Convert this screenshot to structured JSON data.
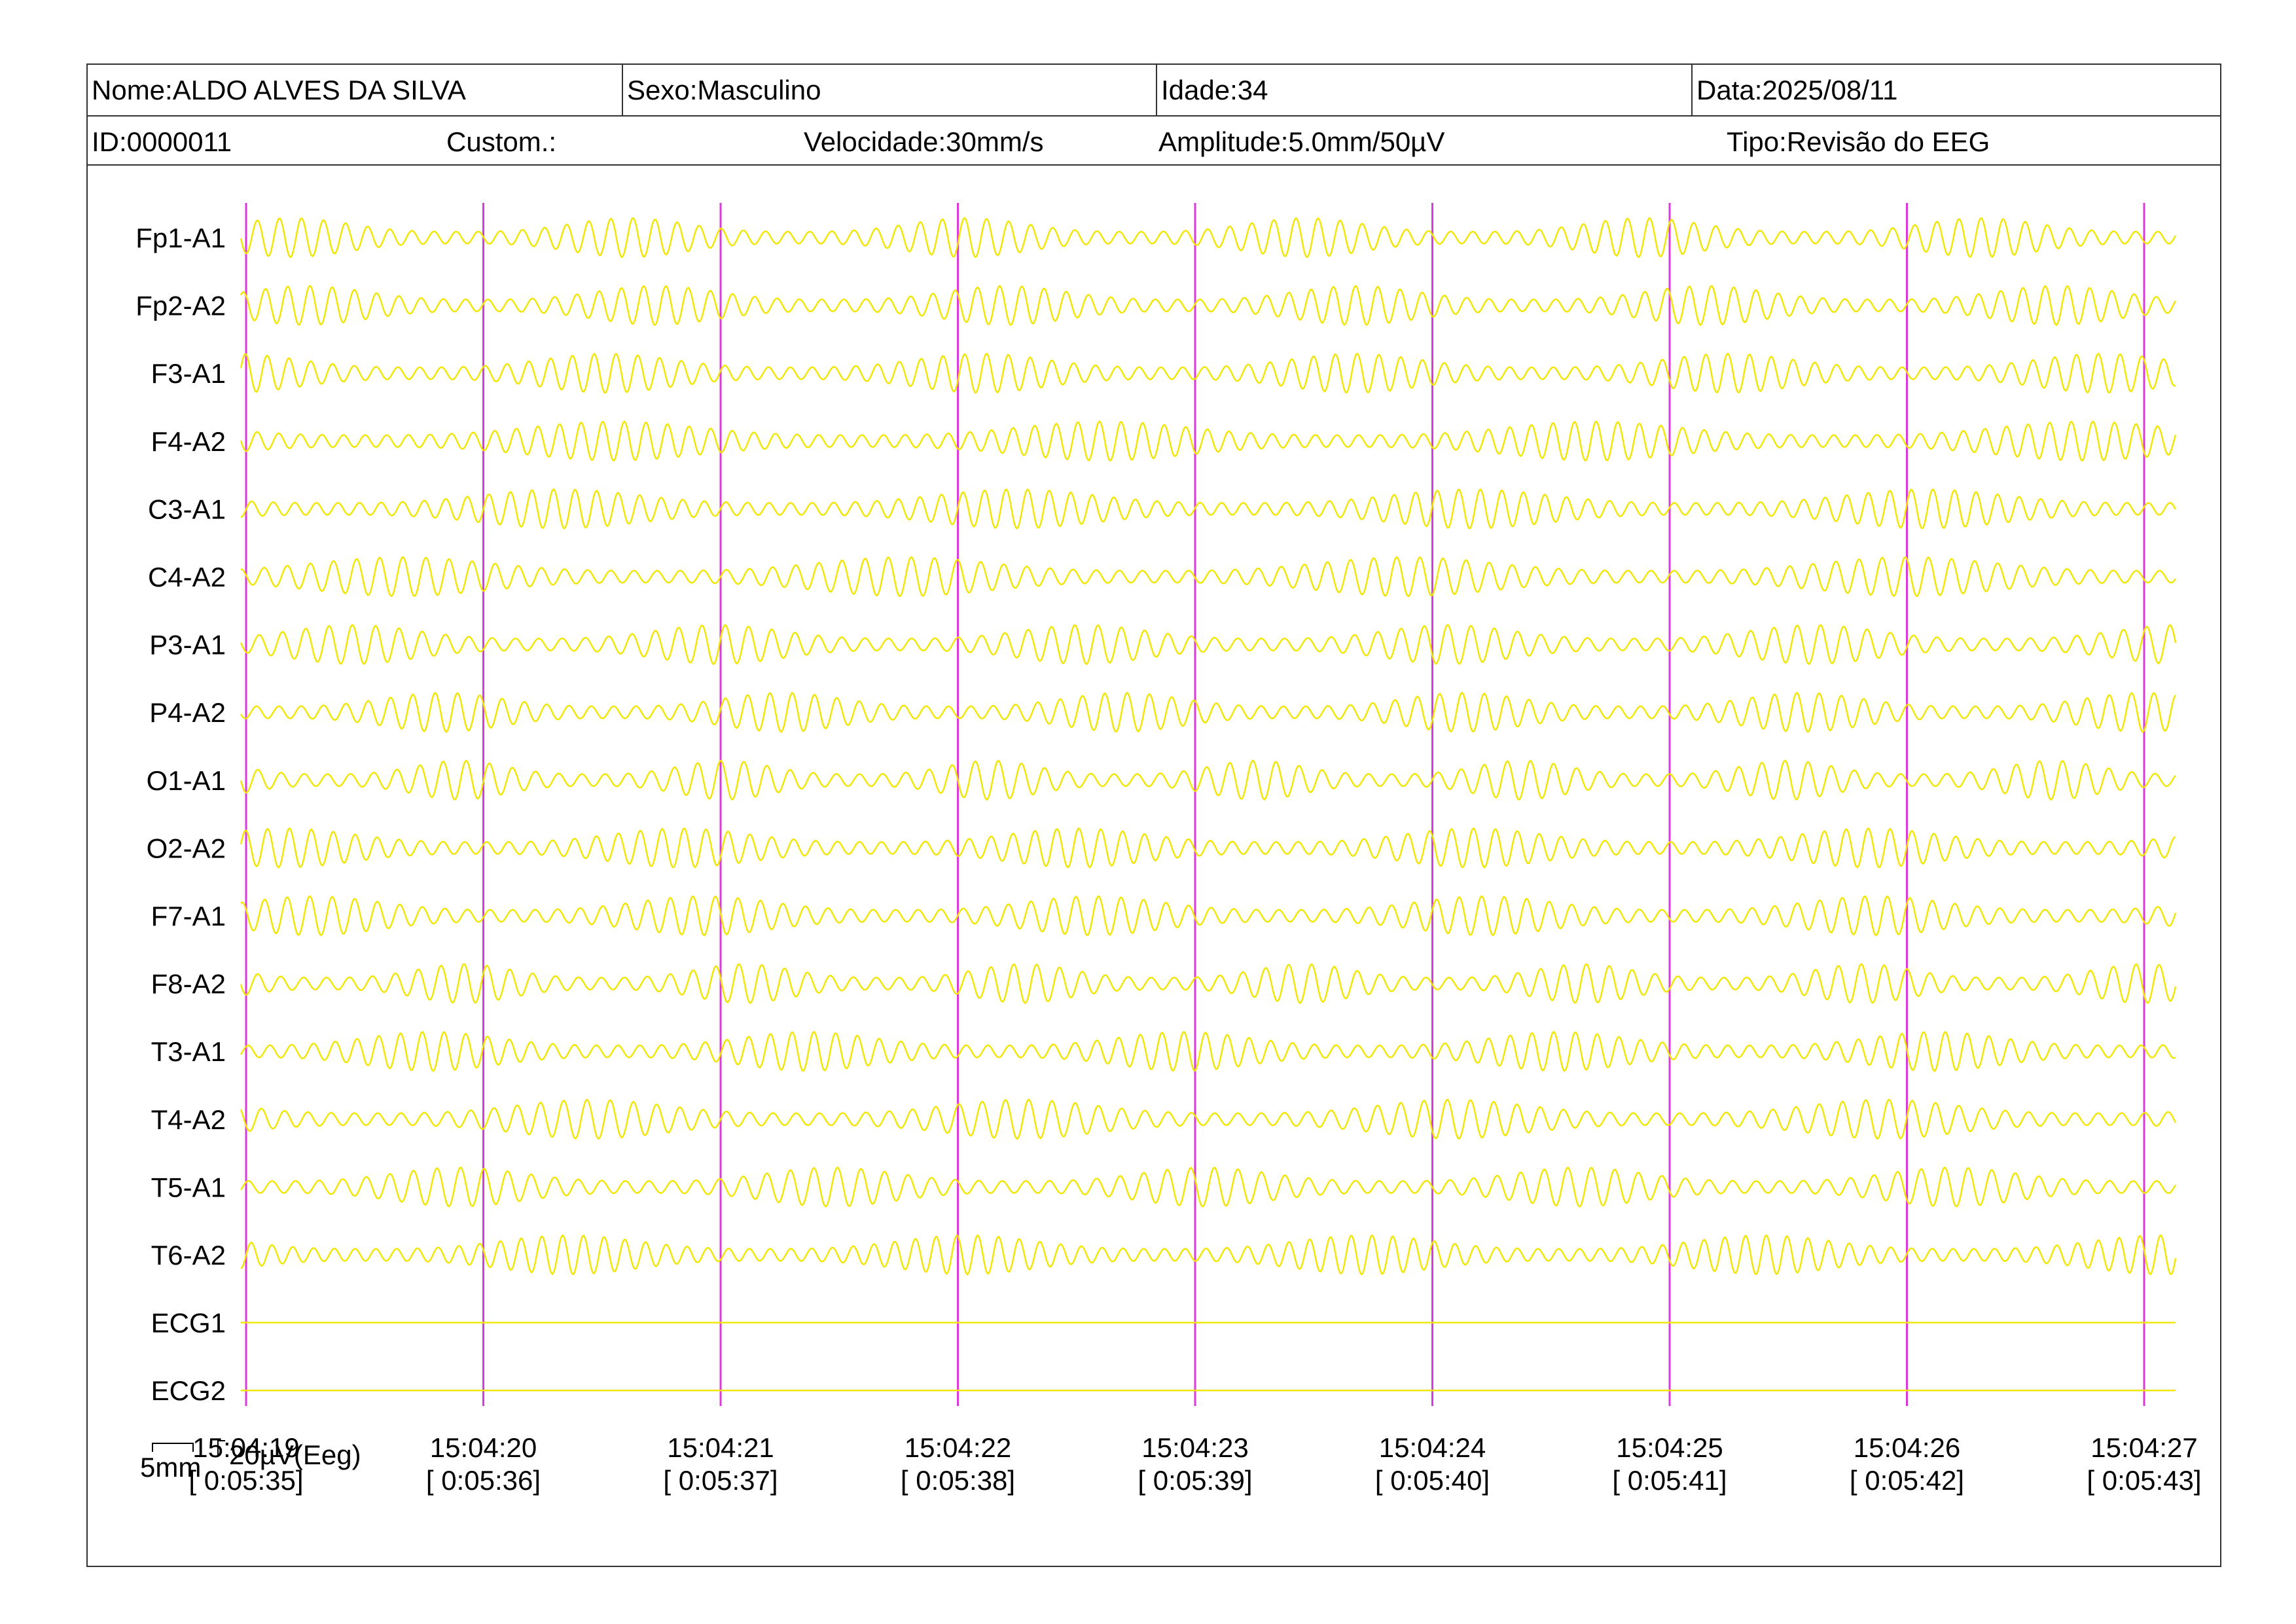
{
  "header": {
    "name": "Nome:ALDO ALVES DA SILVA",
    "sex": "Sexo:Masculino",
    "age": "Idade:34",
    "date": "Data:2025/08/11",
    "id": "ID:0000011",
    "custom": "Custom.:",
    "speed": "Velocidade:30mm/s",
    "amplitude": "Amplitude:5.0mm/50µV",
    "type": "Tipo:Revisão do EEG"
  },
  "channels": [
    {
      "label": "Fp1-A1",
      "kind": "eeg"
    },
    {
      "label": "Fp2-A2",
      "kind": "eeg"
    },
    {
      "label": "F3-A1",
      "kind": "eeg"
    },
    {
      "label": "F4-A2",
      "kind": "eeg"
    },
    {
      "label": "C3-A1",
      "kind": "eeg"
    },
    {
      "label": "C4-A2",
      "kind": "eeg"
    },
    {
      "label": "P3-A1",
      "kind": "eeg"
    },
    {
      "label": "P4-A2",
      "kind": "eeg"
    },
    {
      "label": "O1-A1",
      "kind": "eeg"
    },
    {
      "label": "O2-A2",
      "kind": "eeg"
    },
    {
      "label": "F7-A1",
      "kind": "eeg"
    },
    {
      "label": "F8-A2",
      "kind": "eeg"
    },
    {
      "label": "T3-A1",
      "kind": "eeg"
    },
    {
      "label": "T4-A2",
      "kind": "eeg"
    },
    {
      "label": "T5-A1",
      "kind": "eeg"
    },
    {
      "label": "T6-A2",
      "kind": "eeg"
    },
    {
      "label": "ECG1",
      "kind": "flat"
    },
    {
      "label": "ECG2",
      "kind": "flat"
    }
  ],
  "timestamps": [
    {
      "clock": "15:04:19",
      "elapsed": "[ 0:05:35]"
    },
    {
      "clock": "15:04:20",
      "elapsed": "[ 0:05:36]"
    },
    {
      "clock": "15:04:21",
      "elapsed": "[ 0:05:37]"
    },
    {
      "clock": "15:04:22",
      "elapsed": "[ 0:05:38]"
    },
    {
      "clock": "15:04:23",
      "elapsed": "[ 0:05:39]"
    },
    {
      "clock": "15:04:24",
      "elapsed": "[ 0:05:40]"
    },
    {
      "clock": "15:04:25",
      "elapsed": "[ 0:05:41]"
    },
    {
      "clock": "15:04:26",
      "elapsed": "[ 0:05:42]"
    },
    {
      "clock": "15:04:27",
      "elapsed": "[ 0:05:43]"
    }
  ],
  "scale": {
    "time_label": "5mm",
    "amp_label": "20µV(Eeg)"
  },
  "colors": {
    "trace": "#f2e600",
    "second_marker": "#d93ad9",
    "border": "#333333",
    "background": "#ffffff"
  }
}
